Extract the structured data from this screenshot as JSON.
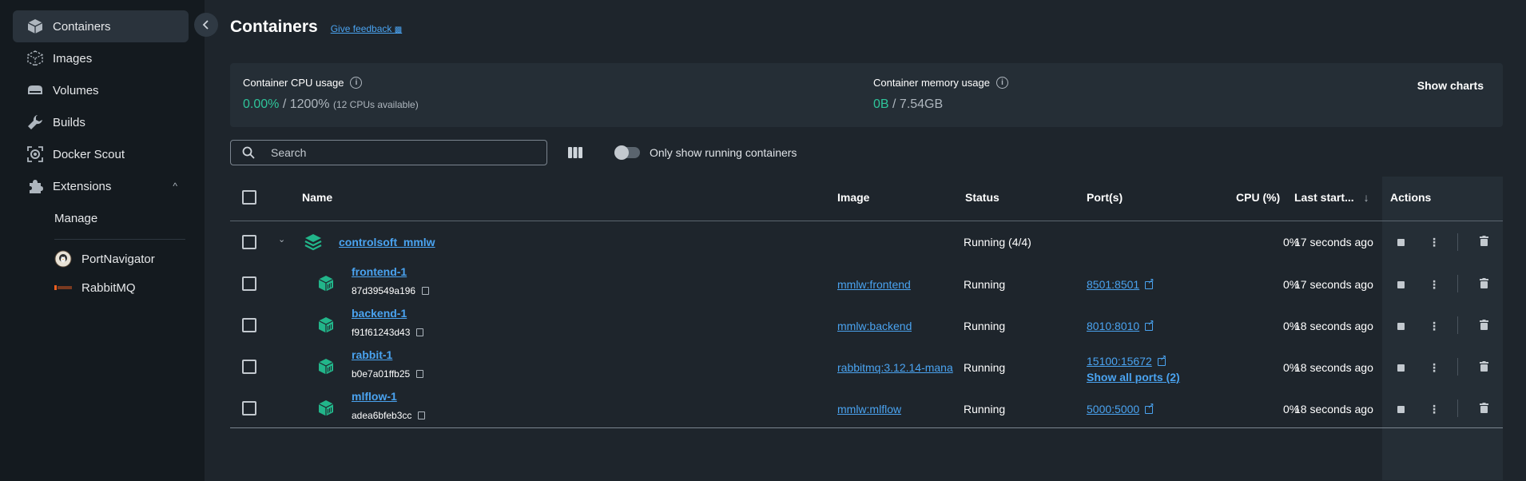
{
  "sidebar": {
    "items": [
      {
        "label": "Containers",
        "icon": "container-icon",
        "active": true
      },
      {
        "label": "Images",
        "icon": "images-icon"
      },
      {
        "label": "Volumes",
        "icon": "volumes-icon"
      },
      {
        "label": "Builds",
        "icon": "wrench-icon"
      },
      {
        "label": "Docker Scout",
        "icon": "scout-icon"
      },
      {
        "label": "Extensions",
        "icon": "puzzle-icon",
        "chevron": "^"
      }
    ],
    "manage_label": "Manage",
    "extensions": [
      {
        "label": "PortNavigator",
        "icon": "portnavigator-icon"
      },
      {
        "label": "RabbitMQ",
        "icon": "rabbitmq-icon"
      }
    ]
  },
  "header": {
    "title": "Containers",
    "feedback": "Give feedback"
  },
  "usage": {
    "cpu_label": "Container CPU usage",
    "cpu_value": "0.00%",
    "cpu_sep": " / 1200% ",
    "cpu_note": "(12 CPUs available)",
    "mem_label": "Container memory usage",
    "mem_value": "0B",
    "mem_sep": " / 7.54GB",
    "show_charts": "Show charts"
  },
  "toolbar": {
    "search_placeholder": "Search",
    "toggle_label": "Only show running containers"
  },
  "table": {
    "headers": {
      "name": "Name",
      "image": "Image",
      "status": "Status",
      "ports": "Port(s)",
      "cpu": "CPU (%)",
      "last_started": "Last start...",
      "actions": "Actions"
    },
    "group": {
      "name": "controlsoft_mmlw",
      "status": "Running (4/4)",
      "cpu": "0%",
      "last_started": "17 seconds ago"
    },
    "rows": [
      {
        "name": "frontend-1",
        "id": "87d39549a196",
        "image": "mmlw:frontend",
        "status": "Running",
        "port": "8501:8501",
        "cpu": "0%",
        "last_started": "17 seconds ago"
      },
      {
        "name": "backend-1",
        "id": "f91f61243d43",
        "image": "mmlw:backend",
        "status": "Running",
        "port": "8010:8010",
        "cpu": "0%",
        "last_started": "18 seconds ago"
      },
      {
        "name": "rabbit-1",
        "id": "b0e7a01ffb25",
        "image": "rabbitmq:3.12.14-mana",
        "status": "Running",
        "port": "15100:15672",
        "extra_ports": "Show all ports (2)",
        "cpu": "0%",
        "last_started": "18 seconds ago"
      },
      {
        "name": "mlflow-1",
        "id": "adea6bfeb3cc",
        "image": "mmlw:mlflow",
        "status": "Running",
        "port": "5000:5000",
        "cpu": "0%",
        "last_started": "18 seconds ago"
      }
    ]
  },
  "colors": {
    "accent_green": "#2fc49a",
    "link_blue": "#4aa3f0",
    "bg": "#1e252c",
    "sidebar_bg": "#141a1f"
  }
}
